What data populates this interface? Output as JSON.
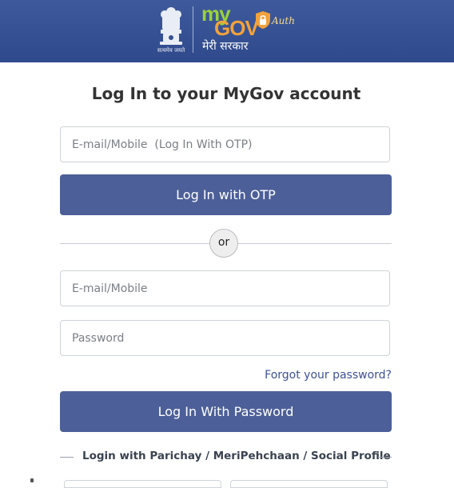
{
  "header": {
    "emblem_motto": "सत्यमेव जयते",
    "logo_my": "my",
    "logo_gov": "GOV",
    "logo_hindi": "मेरी सरकार",
    "auth_label": "Auth"
  },
  "title": "Log In to your MyGov account",
  "otp": {
    "placeholder": "E-mail/Mobile  (Log In With OTP)",
    "value": "",
    "button_label": "Log In with OTP"
  },
  "divider_label": "or",
  "password_login": {
    "email_placeholder": "E-mail/Mobile",
    "email_value": "",
    "password_placeholder": "Password",
    "password_value": "",
    "forgot_label": "Forgot your password?",
    "button_label": "Log In With Password"
  },
  "alt_login_label": "Login with Parichay / MeriPehchaan / Social Profile",
  "colors": {
    "header_bg": "#34508f",
    "button_bg": "#4c5f98",
    "link": "#3d5196"
  }
}
